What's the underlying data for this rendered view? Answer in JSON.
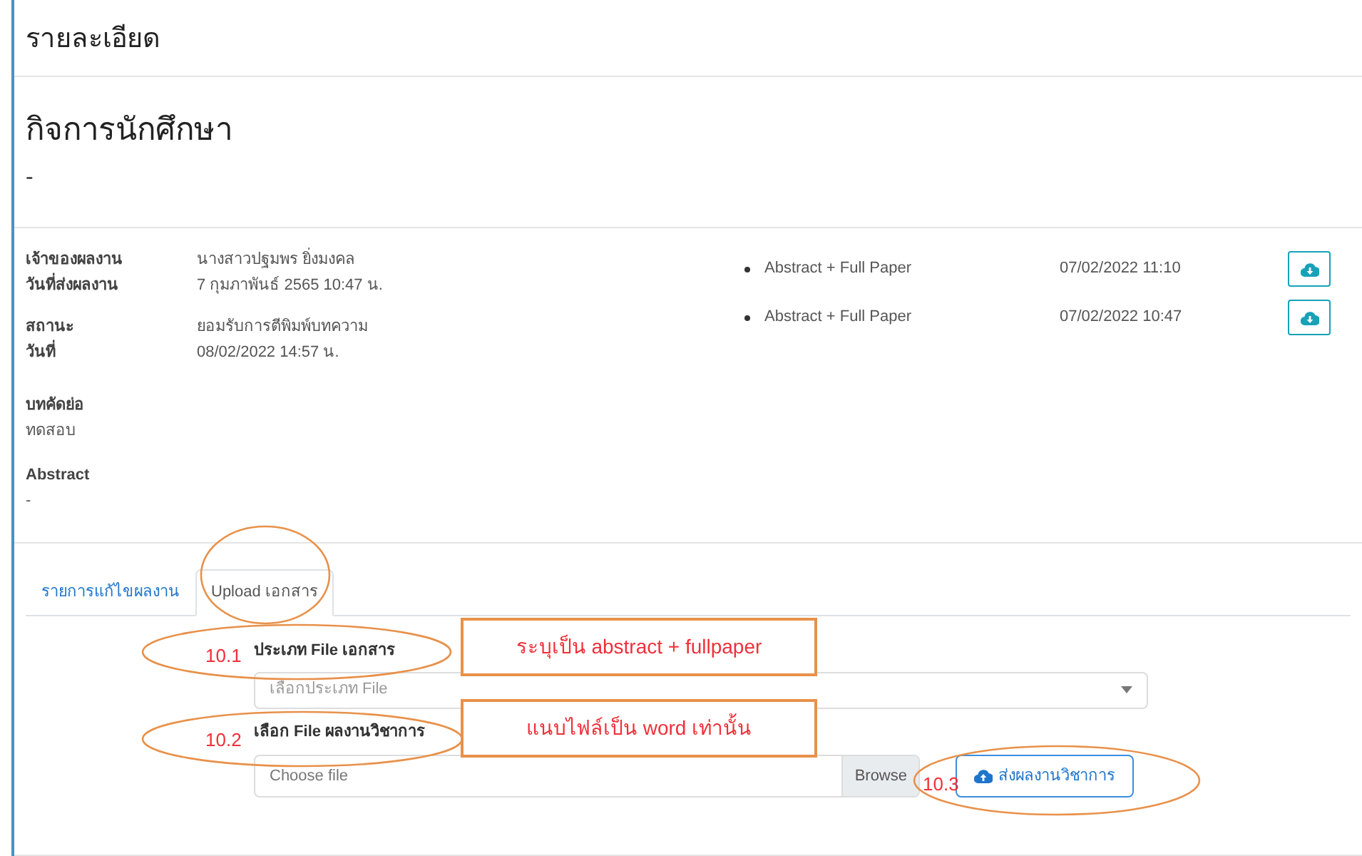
{
  "header": {
    "title": "รายละเอียด"
  },
  "activity": {
    "title": "กิจการนักศึกษา",
    "subtitle": "-"
  },
  "info_groups": [
    {
      "rows": [
        {
          "label": "เจ้าของผลงาน",
          "value": "นางสาวปฐมพร ยิ่งมงคล"
        },
        {
          "label": "วันที่ส่งผลงาน",
          "value": "7 กุมภาพันธ์ 2565 10:47 น."
        }
      ]
    },
    {
      "rows": [
        {
          "label": "สถานะ",
          "value": "ยอมรับการตีพิมพ์บทความ"
        },
        {
          "label": "วันที่",
          "value": "08/02/2022 14:57 น."
        }
      ]
    }
  ],
  "summary_blocks": [
    {
      "label": "บทคัดย่อ",
      "value": "ทดสอบ"
    },
    {
      "label": "Abstract",
      "value": "-"
    }
  ],
  "files": [
    {
      "name": "Abstract + Full Paper",
      "date": "07/02/2022 11:10"
    },
    {
      "name": "Abstract + Full Paper",
      "date": "07/02/2022 10:47"
    }
  ],
  "tabs": [
    {
      "label": "รายการแก้ไขผลงาน",
      "selected": false
    },
    {
      "label": "Upload เอกสาร",
      "selected": true
    }
  ],
  "form": {
    "type_label": "ประเภท File เอกสาร",
    "type_placeholder": "เลือกประเภท File",
    "file_label": "เลือก File ผลงานวิชาการ",
    "file_placeholder": "Choose file",
    "browse": "Browse",
    "submit": "ส่งผลงานวิชาการ"
  },
  "annotations": {
    "markers": [
      {
        "text": "10.1"
      },
      {
        "text": "10.2"
      },
      {
        "text": "10.3"
      }
    ],
    "notes": [
      {
        "text": "ระบุเป็น abstract + fullpaper"
      },
      {
        "text": "แนบไฟล์เป็น word เท่านั้น"
      }
    ]
  }
}
